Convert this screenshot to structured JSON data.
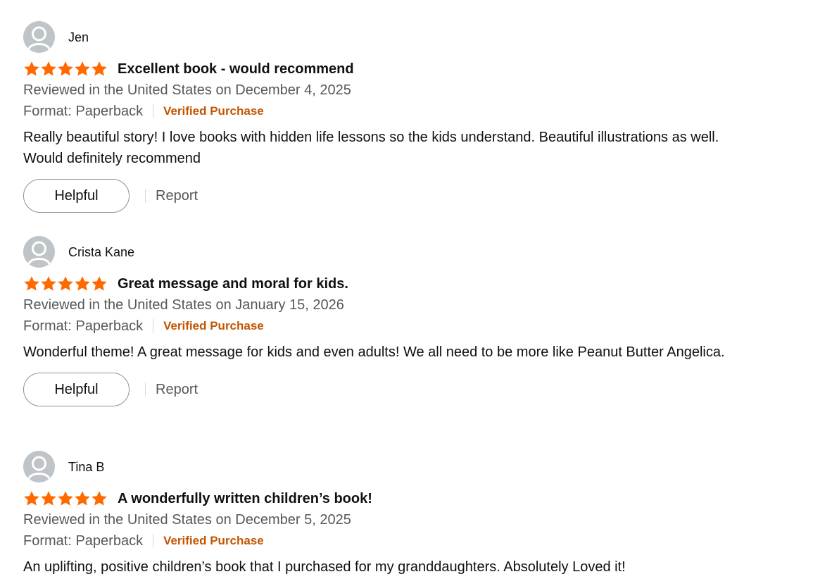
{
  "colors": {
    "star": "#ff6a00",
    "verified": "#c45500",
    "secondary_text": "#565959",
    "avatar_bg": "#bfc4c8"
  },
  "reviews": [
    {
      "author": "Jen",
      "rating": 5,
      "title": "Excellent book - would recommend",
      "date": "Reviewed in the United States on December 4, 2025",
      "format": "Format: Paperback",
      "verified": "Verified Purchase",
      "body": "Really beautiful story! I love books with hidden life lessons so the kids understand. Beautiful illustrations as well. Would definitely recommend",
      "helpful_label": "Helpful",
      "report_label": "Report"
    },
    {
      "author": "Crista Kane",
      "rating": 5,
      "title": "Great message and moral for kids.",
      "date": "Reviewed in the United States on January 15, 2026",
      "format": "Format: Paperback",
      "verified": "Verified Purchase",
      "body": "Wonderful theme! A great message for kids and even adults! We all need to be more like Peanut Butter Angelica.",
      "helpful_label": "Helpful",
      "report_label": "Report"
    },
    {
      "author": "Tina B",
      "rating": 5,
      "title": "A wonderfully written children’s book!",
      "date": "Reviewed in the United States on December 5, 2025",
      "format": "Format: Paperback",
      "verified": "Verified Purchase",
      "body": "An uplifting, positive children’s book that I purchased for my granddaughters. Absolutely Loved it!"
    }
  ]
}
